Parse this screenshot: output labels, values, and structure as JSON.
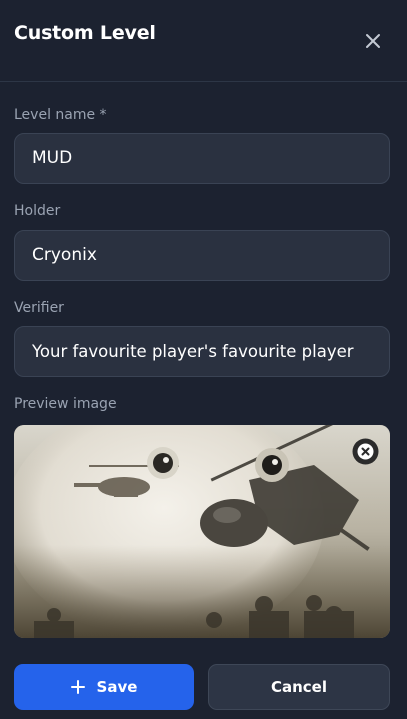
{
  "dialog": {
    "title": "Custom Level",
    "close_icon": "close-icon"
  },
  "fields": {
    "level_name": {
      "label": "Level name *",
      "value": "MUD"
    },
    "holder": {
      "label": "Holder",
      "value": "Cryonix"
    },
    "verifier": {
      "label": "Verifier",
      "value": "Your favourite player's favourite player"
    },
    "preview": {
      "label": "Preview image",
      "remove_icon": "remove-image-icon"
    }
  },
  "actions": {
    "save_label": "Save",
    "save_icon": "plus-icon",
    "cancel_label": "Cancel"
  },
  "colors": {
    "background": "#1c2230",
    "input_bg": "#2a3140",
    "primary": "#2563eb",
    "secondary_button": "#2d3545",
    "label": "#9aa3b2"
  }
}
